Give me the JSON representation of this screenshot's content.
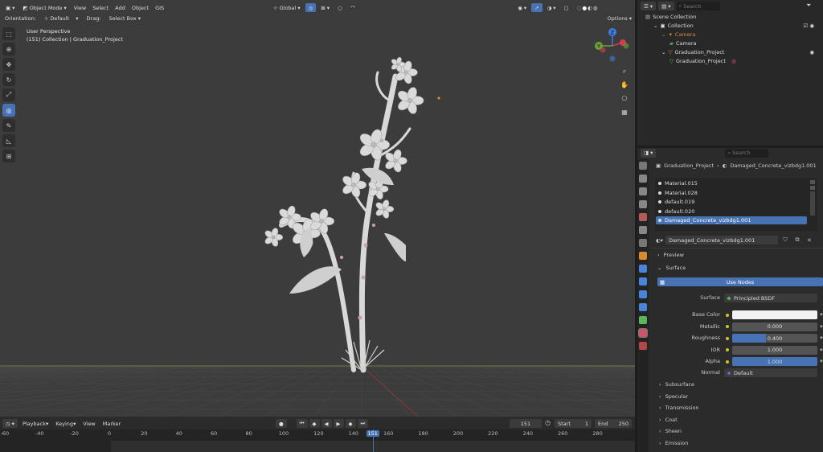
{
  "viewport": {
    "header": {
      "mode": "Object Mode",
      "menus": [
        "View",
        "Select",
        "Add",
        "Object",
        "GIS"
      ],
      "transform": "Global",
      "options": "Options"
    },
    "tool_header": {
      "orientation_label": "Orientation:",
      "orientation_value": "Default",
      "drag_label": "Drag:",
      "drag_value": "Select Box"
    },
    "overlay": {
      "perspective": "User Perspective",
      "collection": "(151) Collection | Graduation_Project"
    },
    "gizmo": {
      "z": "Z",
      "y": "Y"
    }
  },
  "timeline": {
    "menus": [
      "Playback",
      "Keying",
      "View",
      "Marker"
    ],
    "current_frame": "151",
    "start_label": "Start",
    "start": "1",
    "end_label": "End",
    "end": "250",
    "ruler": [
      "-60",
      "-40",
      "-20",
      "0",
      "20",
      "40",
      "60",
      "80",
      "100",
      "120",
      "140",
      "151",
      "160",
      "180",
      "200",
      "220",
      "240",
      "260",
      "280"
    ]
  },
  "outliner": {
    "search_placeholder": "Search",
    "items": [
      {
        "name": "Scene Collection",
        "depth": 0
      },
      {
        "name": "Collection",
        "depth": 1
      },
      {
        "name": "Camera",
        "depth": 2
      },
      {
        "name": "Camera",
        "depth": 3
      },
      {
        "name": "Graduation_Project",
        "depth": 2
      },
      {
        "name": "Graduation_Project",
        "depth": 3
      }
    ]
  },
  "properties": {
    "search_placeholder": "Search",
    "breadcrumb": {
      "object": "Graduation_Project",
      "material": "Damaged_Concrete_vizbdg1.001"
    },
    "slots": [
      "Material.015",
      "Material.028",
      "default.019",
      "default.020",
      "Damaged_Concrete_vizbdg1.001"
    ],
    "material_name": "Damaged_Concrete_vizbdg1.001",
    "preview": "Preview",
    "surface_section": "Surface",
    "use_nodes": "Use Nodes",
    "surface_label": "Surface",
    "surface_value": "Principled BSDF",
    "fields": [
      {
        "label": "Base Color",
        "value": "",
        "fill": 1.0,
        "color": "#f2f2f2"
      },
      {
        "label": "Metallic",
        "value": "0.000",
        "fill": 0.0
      },
      {
        "label": "Roughness",
        "value": "0.400",
        "fill": 0.4
      },
      {
        "label": "IOR",
        "value": "1.000",
        "fill": 0.0
      },
      {
        "label": "Alpha",
        "value": "1.000",
        "fill": 1.0
      }
    ],
    "normal_label": "Normal",
    "normal_value": "Default",
    "subsections": [
      "Subsurface",
      "Specular",
      "Transmission",
      "Coat",
      "Sheen",
      "Emission"
    ]
  },
  "colors": {
    "accent": "#4772b3",
    "gizmo_x": "#d83a4e",
    "gizmo_y": "#6aa23a",
    "gizmo_z": "#3d7de0"
  }
}
